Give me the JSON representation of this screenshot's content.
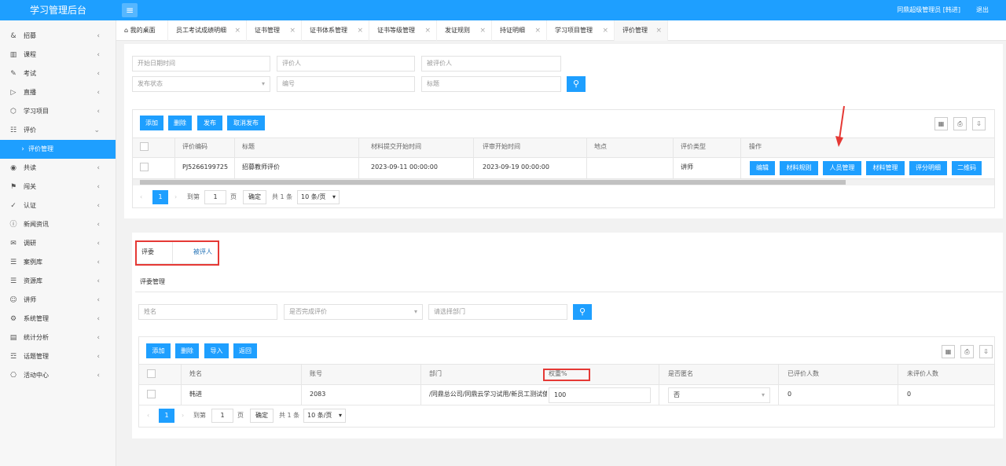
{
  "app": {
    "title": "学习管理后台",
    "user": "同鼎超级管理员 [韩进]",
    "logout": "退出",
    "menu_icon": "hamburger-icon"
  },
  "sidebar": {
    "items": [
      {
        "label": "招募",
        "icon": "&"
      },
      {
        "label": "课程",
        "icon": "▥"
      },
      {
        "label": "考试",
        "icon": "✎"
      },
      {
        "label": "直播",
        "icon": "▷"
      },
      {
        "label": "学习项目",
        "icon": "⬡"
      },
      {
        "label": "评价",
        "icon": "☷"
      },
      {
        "label": "评价管理",
        "icon": "›"
      },
      {
        "label": "共读",
        "icon": "◉"
      },
      {
        "label": "闯关",
        "icon": "⚑"
      },
      {
        "label": "认证",
        "icon": "✓"
      },
      {
        "label": "新闻资讯",
        "icon": "ⓘ"
      },
      {
        "label": "调研",
        "icon": "✉"
      },
      {
        "label": "案例库",
        "icon": "☰"
      },
      {
        "label": "资源库",
        "icon": "☰"
      },
      {
        "label": "讲师",
        "icon": "☺"
      },
      {
        "label": "系统管理",
        "icon": "⚙"
      },
      {
        "label": "统计分析",
        "icon": "▤"
      },
      {
        "label": "话题管理",
        "icon": "☲"
      },
      {
        "label": "活动中心",
        "icon": "⎔"
      }
    ]
  },
  "tabs": [
    {
      "label": "我的桌面",
      "icon": "home-icon"
    },
    {
      "label": "员工考试成绩明细"
    },
    {
      "label": "证书管理"
    },
    {
      "label": "证书体系管理"
    },
    {
      "label": "证书等级管理"
    },
    {
      "label": "发证规则"
    },
    {
      "label": "持证明细"
    },
    {
      "label": "学习项目管理"
    },
    {
      "label": "评价管理"
    }
  ],
  "filters": {
    "start_date": "开始日期时间",
    "evaluator": "评价人",
    "evaluatee": "被评价人",
    "status": "发布状态",
    "code": "编号",
    "title": "标题"
  },
  "toolbar": {
    "add": "添加",
    "delete": "删除",
    "publish": "发布",
    "unpublish": "取消发布"
  },
  "table1": {
    "headers": [
      "评价编码",
      "标题",
      "材料提交开始时间",
      "评审开始时间",
      "地点",
      "评价类型",
      "操作"
    ],
    "row": {
      "code": "PJ5266199725",
      "title": "招募教师评价",
      "submit_start": "2023-09-11 00:00:00",
      "review_start": "2023-09-19 00:00:00",
      "location": "",
      "type": "讲师"
    },
    "actions": [
      "编辑",
      "材料规则",
      "人员管理",
      "材料管理",
      "评分明细",
      "二维码"
    ]
  },
  "pager": {
    "page": "1",
    "goto": "到第",
    "page_unit": "页",
    "confirm": "确定",
    "total": "共 1 条",
    "per_page": "10 条/页"
  },
  "sub_tabs": {
    "tab1": "评委",
    "tab2": "被评人"
  },
  "section_title": "评委管理",
  "filters2": {
    "name": "姓名",
    "completed": "是否完成评价",
    "department": "请选择部门"
  },
  "toolbar2": {
    "add": "添加",
    "delete": "删除",
    "import": "导入",
    "back": "返回"
  },
  "table2": {
    "headers": [
      "姓名",
      "账号",
      "部门",
      "权重%",
      "是否匿名",
      "已评价人数",
      "未评价人数"
    ],
    "row": {
      "name": "韩进",
      "account": "2083",
      "department": "/同鼎总公司/同鼎云学习试用/新员工测试使",
      "weight": "100",
      "anonymous": "否",
      "evaluated": "0",
      "not_evaluated": "0"
    }
  }
}
